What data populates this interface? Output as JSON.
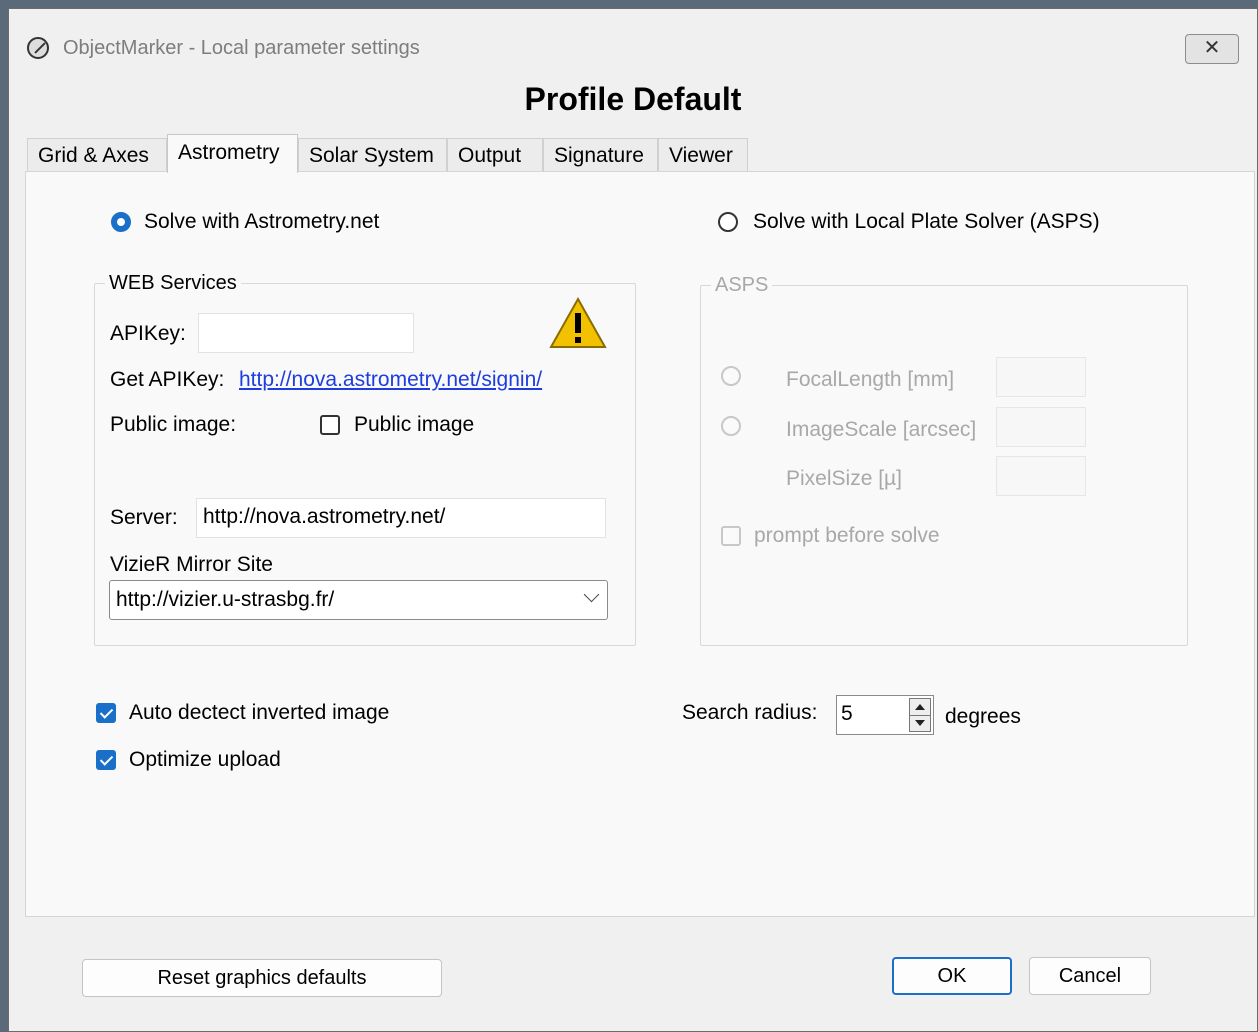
{
  "window": {
    "title": "ObjectMarker - Local parameter settings",
    "close_glyph": "✕"
  },
  "profile_title": "Profile Default",
  "tabs": [
    {
      "label": "Grid & Axes"
    },
    {
      "label": "Astrometry",
      "active": true
    },
    {
      "label": "Solar System"
    },
    {
      "label": "Output"
    },
    {
      "label": "Signature"
    },
    {
      "label": "Viewer"
    }
  ],
  "astrometry": {
    "solve_online_label": "Solve with Astrometry.net",
    "solve_local_label": "Solve with Local Plate Solver (ASPS)",
    "web_services": {
      "legend": "WEB Services",
      "apikey_label": "APIKey:",
      "apikey_value": "",
      "get_apikey_label": "Get APIKey:",
      "get_apikey_link": "http://nova.astrometry.net/signin/",
      "public_image_label": "Public image:",
      "public_image_checkbox": "Public image",
      "server_label": "Server:",
      "server_value": "http://nova.astrometry.net/",
      "vizier_label": "VizieR Mirror Site",
      "vizier_value": "http://vizier.u-strasbg.fr/"
    },
    "asps": {
      "legend": "ASPS",
      "focal_length_label": "FocalLength [mm]",
      "image_scale_label": "ImageScale [arcsec]",
      "pixel_size_label": "PixelSize [µ]",
      "prompt_label": "prompt before solve"
    },
    "auto_detect_label": "Auto dectect inverted image",
    "optimize_upload_label": "Optimize upload",
    "search_radius_label": "Search radius:",
    "search_radius_value": "5",
    "degrees_label": "degrees"
  },
  "buttons": {
    "reset": "Reset graphics defaults",
    "ok": "OK",
    "cancel": "Cancel"
  },
  "colors": {
    "accent": "#1a6fc9",
    "link": "#1e3de0",
    "warning": "#f2c200"
  }
}
